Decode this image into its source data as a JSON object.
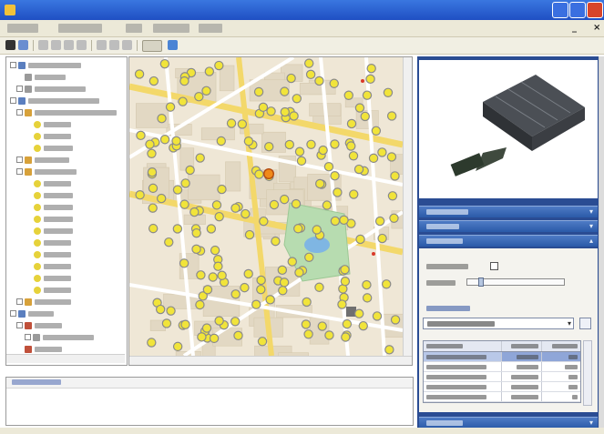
{
  "window": {
    "title": ""
  },
  "menubar": {
    "items": [
      "",
      "",
      "",
      "",
      ""
    ],
    "mdi_controls": [
      "_",
      "×"
    ]
  },
  "tree": {
    "nodes": [
      {
        "level": 0,
        "icon": "network-icon",
        "expanded": true
      },
      {
        "level": 1,
        "icon": "computer-icon"
      },
      {
        "level": 1,
        "icon": "computer-icon",
        "expander": true
      },
      {
        "level": 0,
        "icon": "group-icon",
        "expanded": true
      },
      {
        "level": 1,
        "icon": "folder-icon",
        "expanded": true
      },
      {
        "level": 2,
        "icon": "lamp-icon"
      },
      {
        "level": 2,
        "icon": "lamp-icon"
      },
      {
        "level": 2,
        "icon": "lamp-icon"
      },
      {
        "level": 1,
        "icon": "folder-icon",
        "expander": true
      },
      {
        "level": 1,
        "icon": "folder-icon",
        "expanded": true
      },
      {
        "level": 2,
        "icon": "lamp-icon"
      },
      {
        "level": 2,
        "icon": "lamp-icon"
      },
      {
        "level": 2,
        "icon": "lamp-icon"
      },
      {
        "level": 2,
        "icon": "lamp-icon"
      },
      {
        "level": 2,
        "icon": "lamp-icon"
      },
      {
        "level": 2,
        "icon": "lamp-icon"
      },
      {
        "level": 2,
        "icon": "lamp-icon"
      },
      {
        "level": 2,
        "icon": "lamp-icon"
      },
      {
        "level": 2,
        "icon": "lamp-icon"
      },
      {
        "level": 2,
        "icon": "lamp-icon"
      },
      {
        "level": 1,
        "icon": "folder-icon",
        "expander": true
      },
      {
        "level": 0,
        "icon": "scheme-icon",
        "expanded": true
      },
      {
        "level": 1,
        "icon": "scheme-icon",
        "expanded": true
      },
      {
        "level": 2,
        "icon": "computer-icon",
        "expander": true
      },
      {
        "level": 1,
        "icon": "scheme-icon"
      }
    ]
  },
  "messages": {
    "header": ""
  },
  "right_panel": {
    "sections": [
      "",
      "",
      ""
    ],
    "bottom_section": "",
    "control": {
      "enable_label": "",
      "enabled": false,
      "brightness_label": "",
      "brightness_level": 0.12,
      "schedule_label": "",
      "schedule_value": ""
    },
    "grid": {
      "columns": [
        "",
        "",
        ""
      ],
      "rows": [
        {
          "condition": "",
          "value": "",
          "brightness": "",
          "selected": true
        },
        {
          "condition": "",
          "value": "",
          "brightness": ""
        },
        {
          "condition": "",
          "value": "",
          "brightness": ""
        },
        {
          "condition": "",
          "value": "",
          "brightness": ""
        },
        {
          "condition": "",
          "value": "",
          "brightness": ""
        }
      ]
    }
  },
  "map": {
    "lamp_color": "#f1e43a",
    "lamp_active_color": "#f08a1a",
    "lamp_count": 190
  },
  "colors": {
    "titlebar": "#2a5fd0",
    "accent": "#2a4c93",
    "section_header": "#3e6cb8"
  }
}
